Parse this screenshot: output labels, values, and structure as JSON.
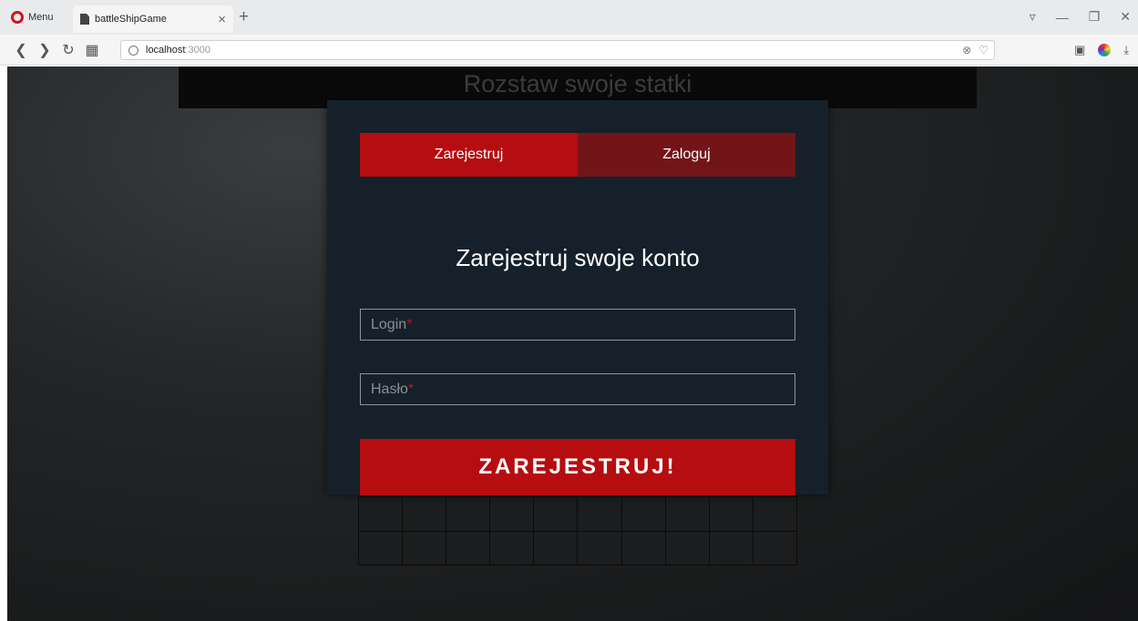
{
  "browser": {
    "menu_label": "Menu",
    "tab_title": "battleShipGame",
    "tab_close": "×",
    "new_tab": "+",
    "url_host": "localhost",
    "url_port": ":3000",
    "brand_color": "#d4121b",
    "icons": [
      "opera-logo",
      "document-icon",
      "back-icon",
      "forward-icon",
      "reload-icon",
      "speed-dial-icon",
      "globe-icon",
      "block-icon",
      "heart-icon",
      "snapshot-icon",
      "color-wheel-icon",
      "download-icon",
      "tab-menu-icon",
      "minimize-icon",
      "restore-icon",
      "close-icon"
    ]
  },
  "page": {
    "header_title": "Rozstaw swoje statki",
    "background_color": "#1a1c1d"
  },
  "modal": {
    "tab_register": "Zarejestruj",
    "tab_login": "Zaloguj",
    "active_tab": "Zarejestruj",
    "title": "Zarejestruj swoje konto",
    "login_label": "Login",
    "password_label": "Hasło",
    "required_mark": "*",
    "submit_label": "ZAREJESTRUJ!",
    "accent_color": "#b50d10",
    "inactive_tab_color": "#731419",
    "panel_color": "#15202b"
  }
}
